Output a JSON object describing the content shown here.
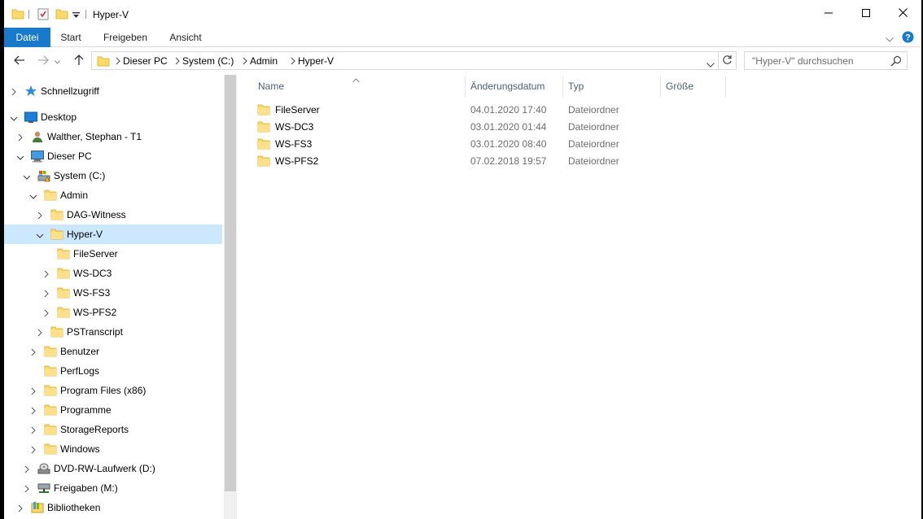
{
  "window": {
    "title": "Hyper-V",
    "controls": [
      "minimize-icon",
      "maximize-icon",
      "close-icon"
    ]
  },
  "ribbon": {
    "tabs": [
      {
        "label": "Datei",
        "active": true
      },
      {
        "label": "Start"
      },
      {
        "label": "Freigeben"
      },
      {
        "label": "Ansicht"
      }
    ],
    "help_icon": "help-icon",
    "accent": "#1979ca"
  },
  "address": {
    "segments": [
      "Dieser PC",
      "System (C:)",
      "Admin",
      "Hyper-V"
    ],
    "search_placeholder": "\"Hyper-V\" durchsuchen"
  },
  "tree": [
    {
      "label": "Schnellzugriff",
      "icon": "star-icon",
      "chevron": "right"
    },
    {
      "label": "Desktop",
      "icon": "desktop-icon",
      "chevron": "down"
    },
    {
      "label": "Walther, Stephan - T1",
      "icon": "user-icon",
      "chevron": "right"
    },
    {
      "label": "Dieser PC",
      "icon": "pc-icon",
      "chevron": "down"
    },
    {
      "label": "System (C:)",
      "icon": "drive-icon",
      "chevron": "down"
    },
    {
      "label": "Admin",
      "icon": "folder-icon",
      "chevron": "down"
    },
    {
      "label": "DAG-Witness",
      "icon": "folder-icon",
      "chevron": "right"
    },
    {
      "label": "Hyper-V",
      "icon": "folder-icon",
      "chevron": "down",
      "selected": true
    },
    {
      "label": "FileServer",
      "icon": "folder-icon",
      "chevron": "none"
    },
    {
      "label": "WS-DC3",
      "icon": "folder-icon",
      "chevron": "right"
    },
    {
      "label": "WS-FS3",
      "icon": "folder-icon",
      "chevron": "right"
    },
    {
      "label": "WS-PFS2",
      "icon": "folder-icon",
      "chevron": "right"
    },
    {
      "label": "PSTranscript",
      "icon": "folder-icon",
      "chevron": "right"
    },
    {
      "label": "Benutzer",
      "icon": "folder-icon",
      "chevron": "right"
    },
    {
      "label": "PerfLogs",
      "icon": "folder-icon",
      "chevron": "none"
    },
    {
      "label": "Program Files (x86)",
      "icon": "folder-icon",
      "chevron": "right"
    },
    {
      "label": "Programme",
      "icon": "folder-icon",
      "chevron": "right"
    },
    {
      "label": "StorageReports",
      "icon": "folder-icon",
      "chevron": "right"
    },
    {
      "label": "Windows",
      "icon": "folder-icon",
      "chevron": "right"
    },
    {
      "label": "DVD-RW-Laufwerk (D:)",
      "icon": "dvd-icon",
      "chevron": "right"
    },
    {
      "label": "Freigaben (M:)",
      "icon": "network-drive-icon",
      "chevron": "right"
    },
    {
      "label": "Bibliotheken",
      "icon": "library-icon",
      "chevron": "right"
    }
  ],
  "columns": [
    "Name",
    "Änderungsdatum",
    "Typ",
    "Größe"
  ],
  "files": [
    {
      "name": "FileServer",
      "date": "04.01.2020 17:40",
      "type": "Dateiordner"
    },
    {
      "name": "WS-DC3",
      "date": "03.01.2020 01:44",
      "type": "Dateiordner"
    },
    {
      "name": "WS-FS3",
      "date": "03.01.2020 08:40",
      "type": "Dateiordner"
    },
    {
      "name": "WS-PFS2",
      "date": "07.02.2018 19:57",
      "type": "Dateiordner"
    }
  ],
  "colors": {
    "folder": "#ffd96b",
    "selection": "#cce8ff",
    "header_text": "#4c607a"
  }
}
